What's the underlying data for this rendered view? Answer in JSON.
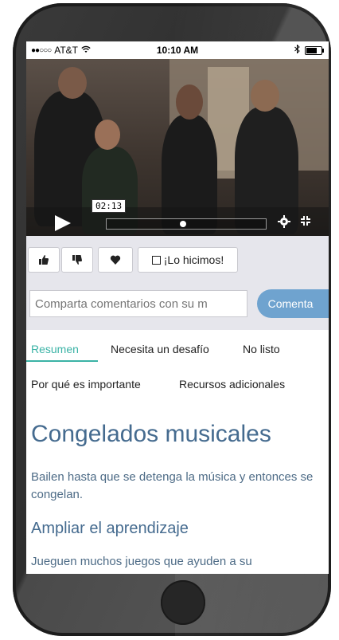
{
  "status_bar": {
    "carrier": "AT&T",
    "time": "10:10 AM"
  },
  "video": {
    "current_time": "02:13",
    "progress_fraction": 0.48
  },
  "actions": {
    "did_it_label": "¡Lo hicimos!"
  },
  "comment": {
    "placeholder": "Comparta comentarios con su m",
    "submit_label": "Comenta"
  },
  "tabs": [
    {
      "label": "Resumen",
      "active": true
    },
    {
      "label": "Necesita un desafío",
      "active": false
    },
    {
      "label": "No listo",
      "active": false
    },
    {
      "label": "Por qué es importante",
      "active": false
    },
    {
      "label": "Recursos adicionales",
      "active": false
    }
  ],
  "article": {
    "title": "Congelados musicales",
    "description": "Bailen hasta que se detenga la música y entonces se congelan.",
    "subtitle": "Ampliar el aprendizaje",
    "body": "Jueguen muchos juegos que ayuden a su"
  },
  "colors": {
    "accent_teal": "#3bb3a6",
    "button_blue": "#6fa3cf",
    "text_blue": "#456b8f"
  }
}
